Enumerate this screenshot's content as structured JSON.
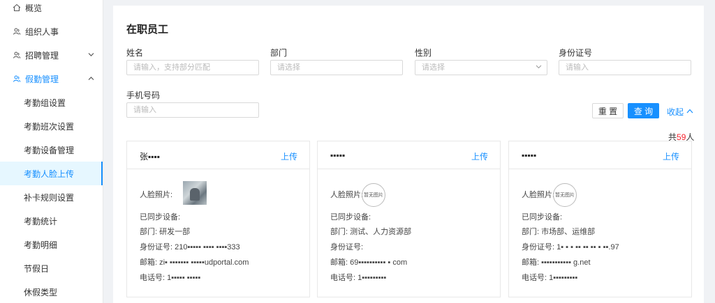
{
  "sidebar": {
    "items": [
      {
        "label": "概览",
        "icon": "home-icon"
      },
      {
        "label": "组织人事",
        "icon": "user-group-icon"
      },
      {
        "label": "招聘管理",
        "icon": "user-group-icon"
      },
      {
        "label": "假勤管理",
        "icon": "user-group-icon"
      }
    ],
    "sub_items": [
      "考勤组设置",
      "考勤班次设置",
      "考勤设备管理",
      "考勤人脸上传",
      "补卡规则设置",
      "考勤统计",
      "考勤明细",
      "节假日",
      "休假类型"
    ],
    "active_sub": "考勤人脸上传",
    "accent_color": "#1890ff"
  },
  "page": {
    "title": "在职员工"
  },
  "filters": {
    "name": {
      "label": "姓名",
      "placeholder": "请输入，支持部分匹配"
    },
    "dept": {
      "label": "部门",
      "placeholder": "请选择"
    },
    "gender": {
      "label": "性别",
      "placeholder": "请选择"
    },
    "idcard": {
      "label": "身份证号",
      "placeholder": "请输入"
    },
    "phone": {
      "label": "手机号码",
      "placeholder": "请输入"
    }
  },
  "actions": {
    "reset": "重 置",
    "query": "查 询",
    "collapse": "收起"
  },
  "total": {
    "prefix": "共",
    "count": "59",
    "suffix": "人"
  },
  "card_labels": {
    "upload": "上传",
    "photo": "人脸照片:",
    "synced": "已同步设备:",
    "no_photo": "暂无图片"
  },
  "employees": [
    {
      "name": "张▪▪▪▪",
      "has_photo": true,
      "dept": "部门: 研发一部",
      "idcard": "身份证号: 210▪▪▪▪▪ ▪▪▪▪ ▪▪▪▪333",
      "email": "邮箱: zi▪ ▪▪▪▪▪▪▪ ▪▪▪▪▪udportal.com",
      "phone": "电话号: 1▪▪▪▪▪ ▪▪▪▪▪"
    },
    {
      "name": "▪▪▪▪▪",
      "has_photo": false,
      "dept": "部门: 测试、人力资源部",
      "idcard": "身份证号:",
      "email": "邮箱: 69▪▪▪▪▪▪▪▪▪▪ ▪ com",
      "phone": "电话号: 1▪▪▪▪▪▪▪▪▪"
    },
    {
      "name": "▪▪▪▪▪",
      "has_photo": false,
      "dept": "部门: 市场部、运维部",
      "idcard": "身份证号: 1▪ ▪ ▪ ▪▪ ▪▪ ▪▪ ▪ ▪▪.97",
      "email": "邮箱: ▪▪▪▪▪▪▪▪▪▪▪ g.net",
      "phone": "电话号: 1▪▪▪▪▪▪▪▪▪"
    }
  ]
}
